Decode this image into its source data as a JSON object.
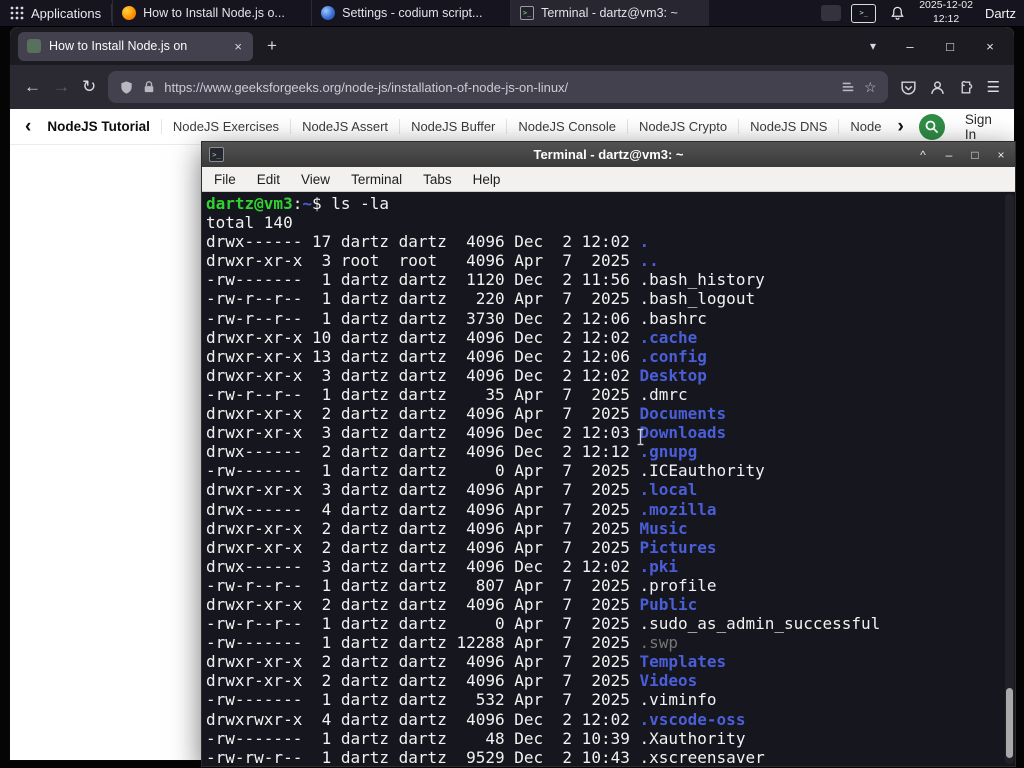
{
  "panel": {
    "applications_label": "Applications",
    "window_buttons": [
      {
        "title": "How to Install Node.js o..."
      },
      {
        "title": "Settings - codium script..."
      },
      {
        "title": "Terminal - dartz@vm3: ~"
      }
    ],
    "clock": {
      "date": "2025-12-02",
      "time": "12:12"
    },
    "user_label": "Dartz"
  },
  "browser": {
    "tab_title": "How to Install Node.js on",
    "url": "https://www.geeksforgeeks.org/node-js/installation-of-node-js-on-linux/"
  },
  "site_nav": {
    "items": [
      "NodeJS Tutorial",
      "NodeJS Exercises",
      "NodeJS Assert",
      "NodeJS Buffer",
      "NodeJS Console",
      "NodeJS Crypto",
      "NodeJS DNS",
      "Node"
    ],
    "sign_in_label": "Sign In"
  },
  "terminal": {
    "title": "Terminal - dartz@vm3: ~",
    "menu": [
      "File",
      "Edit",
      "View",
      "Terminal",
      "Tabs",
      "Help"
    ],
    "lines": [
      [
        {
          "t": "dartz@vm3",
          "c": "g"
        },
        {
          "t": ":",
          "c": "d"
        },
        {
          "t": "~",
          "c": "b"
        },
        {
          "t": "$ ls -la",
          "c": "d"
        }
      ],
      [
        {
          "t": "total 140",
          "c": "d"
        }
      ],
      [
        {
          "t": "drwx------ 17 dartz dartz  4096 Dec  2 12:02 ",
          "c": "d"
        },
        {
          "t": ".",
          "c": "b"
        }
      ],
      [
        {
          "t": "drwxr-xr-x  3 root  root   4096 Apr  7  2025 ",
          "c": "d"
        },
        {
          "t": "..",
          "c": "b"
        }
      ],
      [
        {
          "t": "-rw-------  1 dartz dartz  1120 Dec  2 11:56 ",
          "c": "d"
        },
        {
          "t": ".bash_history",
          "c": "d"
        }
      ],
      [
        {
          "t": "-rw-r--r--  1 dartz dartz   220 Apr  7  2025 ",
          "c": "d"
        },
        {
          "t": ".bash_logout",
          "c": "d"
        }
      ],
      [
        {
          "t": "-rw-r--r--  1 dartz dartz  3730 Dec  2 12:06 ",
          "c": "d"
        },
        {
          "t": ".bashrc",
          "c": "d"
        }
      ],
      [
        {
          "t": "drwxr-xr-x 10 dartz dartz  4096 Dec  2 12:02 ",
          "c": "d"
        },
        {
          "t": ".cache",
          "c": "b"
        }
      ],
      [
        {
          "t": "drwxr-xr-x 13 dartz dartz  4096 Dec  2 12:06 ",
          "c": "d"
        },
        {
          "t": ".config",
          "c": "b"
        }
      ],
      [
        {
          "t": "drwxr-xr-x  3 dartz dartz  4096 Dec  2 12:02 ",
          "c": "d"
        },
        {
          "t": "Desktop",
          "c": "b"
        }
      ],
      [
        {
          "t": "-rw-r--r--  1 dartz dartz    35 Apr  7  2025 ",
          "c": "d"
        },
        {
          "t": ".dmrc",
          "c": "d"
        }
      ],
      [
        {
          "t": "drwxr-xr-x  2 dartz dartz  4096 Apr  7  2025 ",
          "c": "d"
        },
        {
          "t": "Documents",
          "c": "b"
        }
      ],
      [
        {
          "t": "drwxr-xr-x  3 dartz dartz  4096 Dec  2 12:03 ",
          "c": "d"
        },
        {
          "t": "Downloads",
          "c": "b"
        }
      ],
      [
        {
          "t": "drwx------  2 dartz dartz  4096 Dec  2 12:12 ",
          "c": "d"
        },
        {
          "t": ".gnupg",
          "c": "b"
        }
      ],
      [
        {
          "t": "-rw-------  1 dartz dartz     0 Apr  7  2025 ",
          "c": "d"
        },
        {
          "t": ".ICEauthority",
          "c": "d"
        }
      ],
      [
        {
          "t": "drwxr-xr-x  3 dartz dartz  4096 Apr  7  2025 ",
          "c": "d"
        },
        {
          "t": ".local",
          "c": "b"
        }
      ],
      [
        {
          "t": "drwx------  4 dartz dartz  4096 Apr  7  2025 ",
          "c": "d"
        },
        {
          "t": ".mozilla",
          "c": "b"
        }
      ],
      [
        {
          "t": "drwxr-xr-x  2 dartz dartz  4096 Apr  7  2025 ",
          "c": "d"
        },
        {
          "t": "Music",
          "c": "b"
        }
      ],
      [
        {
          "t": "drwxr-xr-x  2 dartz dartz  4096 Apr  7  2025 ",
          "c": "d"
        },
        {
          "t": "Pictures",
          "c": "b"
        }
      ],
      [
        {
          "t": "drwx------  3 dartz dartz  4096 Dec  2 12:02 ",
          "c": "d"
        },
        {
          "t": ".pki",
          "c": "b"
        }
      ],
      [
        {
          "t": "-rw-r--r--  1 dartz dartz   807 Apr  7  2025 ",
          "c": "d"
        },
        {
          "t": ".profile",
          "c": "d"
        }
      ],
      [
        {
          "t": "drwxr-xr-x  2 dartz dartz  4096 Apr  7  2025 ",
          "c": "d"
        },
        {
          "t": "Public",
          "c": "b"
        }
      ],
      [
        {
          "t": "-rw-r--r--  1 dartz dartz     0 Apr  7  2025 ",
          "c": "d"
        },
        {
          "t": ".sudo_as_admin_successful",
          "c": "d"
        }
      ],
      [
        {
          "t": "-rw-------  1 dartz dartz 12288 Apr  7  2025 ",
          "c": "d"
        },
        {
          "t": ".swp",
          "c": "dim"
        }
      ],
      [
        {
          "t": "drwxr-xr-x  2 dartz dartz  4096 Apr  7  2025 ",
          "c": "d"
        },
        {
          "t": "Templates",
          "c": "b"
        }
      ],
      [
        {
          "t": "drwxr-xr-x  2 dartz dartz  4096 Apr  7  2025 ",
          "c": "d"
        },
        {
          "t": "Videos",
          "c": "b"
        }
      ],
      [
        {
          "t": "-rw-------  1 dartz dartz   532 Apr  7  2025 ",
          "c": "d"
        },
        {
          "t": ".viminfo",
          "c": "d"
        }
      ],
      [
        {
          "t": "drwxrwxr-x  4 dartz dartz  4096 Dec  2 12:02 ",
          "c": "d"
        },
        {
          "t": ".vscode-oss",
          "c": "b"
        }
      ],
      [
        {
          "t": "-rw-------  1 dartz dartz    48 Dec  2 10:39 ",
          "c": "d"
        },
        {
          "t": ".Xauthority",
          "c": "d"
        }
      ],
      [
        {
          "t": "-rw-rw-r--  1 dartz dartz  9529 Dec  2 10:43 ",
          "c": "d"
        },
        {
          "t": ".xscreensaver",
          "c": "d"
        }
      ]
    ]
  },
  "icons": {
    "prompt_glyph": ">_",
    "back": "←",
    "forward": "→",
    "reload": "↻",
    "menu": "☰",
    "star": "☆",
    "new_tab": "+",
    "tab_close": "×",
    "list_tabs": "▾",
    "win_min": "–",
    "win_max": "□",
    "win_close": "×",
    "term_shade": "^",
    "term_min": "–",
    "term_max": "□",
    "term_close": "×",
    "nav_prev": "‹",
    "nav_next": "›"
  }
}
